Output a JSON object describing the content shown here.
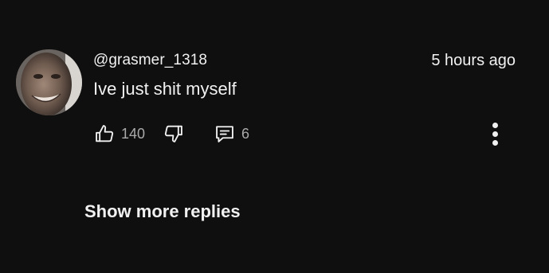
{
  "comment": {
    "username": "@grasmer_1318",
    "timestamp": "5 hours ago",
    "text": "Ive just shit myself",
    "like_count": "140",
    "reply_count": "6"
  },
  "icons": {
    "like": "thumbs-up-icon",
    "dislike": "thumbs-down-icon",
    "reply": "comment-icon",
    "more": "more-vertical-icon"
  },
  "footer": {
    "show_more_label": "Show more replies"
  },
  "colors": {
    "background": "#0f0f0f",
    "text_primary": "#f1f1f1",
    "text_secondary": "#aaaaaa"
  }
}
